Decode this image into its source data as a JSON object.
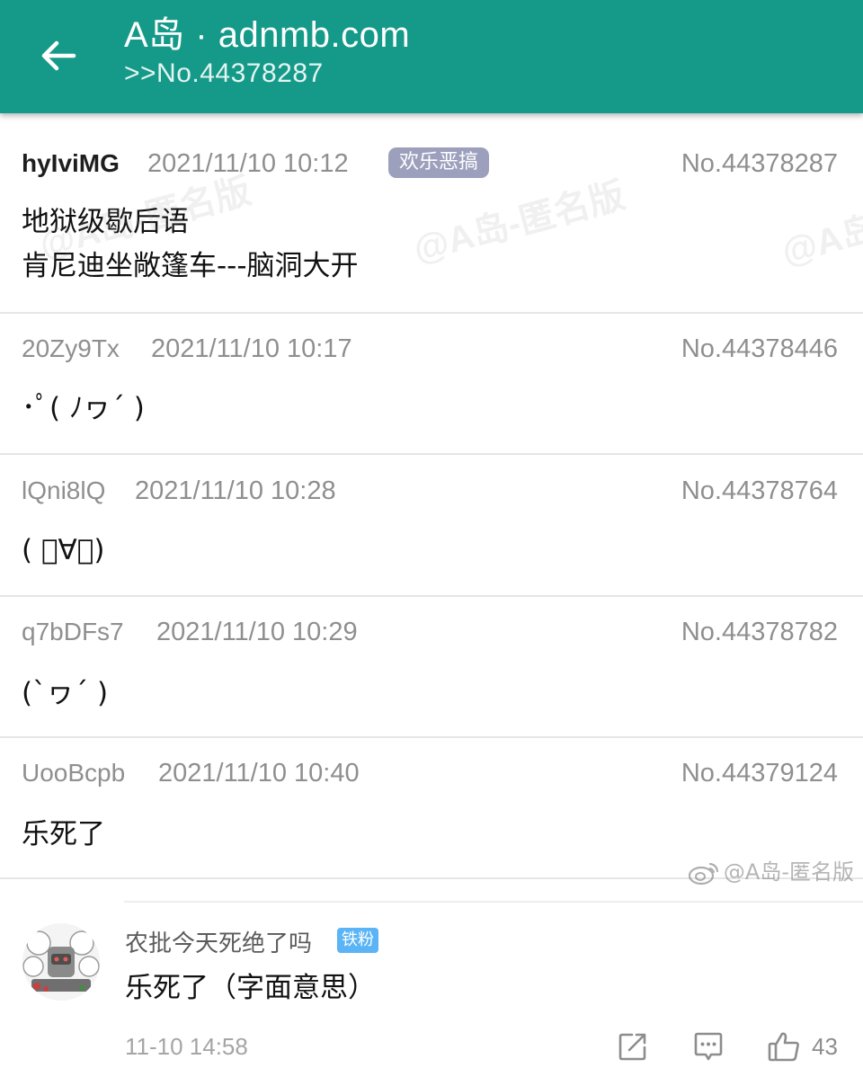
{
  "header": {
    "title": "A岛 · adnmb.com",
    "subtitle": ">>No.44378287",
    "back_icon": "arrow-left-icon",
    "bar_color": "#159a89"
  },
  "posts": [
    {
      "user": "hyIviMG",
      "time": "2021/11/10 10:12",
      "tag": "欢乐恶搞",
      "no": "No.44378287",
      "lines": [
        "地狱级歇后语",
        "肯尼迪坐敞篷车---脑洞大开"
      ]
    },
    {
      "user": "20Zy9Tx",
      "time": "2021/11/10 10:17",
      "no": "No.44378446",
      "lines": [
        "･ﾟ( ﾉヮ´ )"
      ]
    },
    {
      "user": "lQni8lQ",
      "time": "2021/11/10 10:28",
      "no": "No.44378764",
      "lines": [
        "( ﾟ∀。)"
      ]
    },
    {
      "user": "q7bDFs7",
      "time": "2021/11/10 10:29",
      "no": "No.44378782",
      "lines": [
        "(`ヮ´ )"
      ]
    },
    {
      "user": "UooBcpb",
      "time": "2021/11/10 10:40",
      "no": "No.44379124",
      "lines": [
        "乐死了"
      ]
    }
  ],
  "watermarks": [
    "@A岛-匿名版",
    "@A岛-匿名版",
    "@A岛"
  ],
  "weibo_watermark": "@A岛-匿名版",
  "comment": {
    "user": "农批今天死绝了吗",
    "badge": "铁粉",
    "text": "乐死了（字面意思）",
    "time": "11-10 14:58",
    "actions": {
      "share_icon": "share-icon",
      "comment_icon": "comment-icon",
      "like_icon": "thumbs-up-icon",
      "like_count": "43"
    }
  }
}
